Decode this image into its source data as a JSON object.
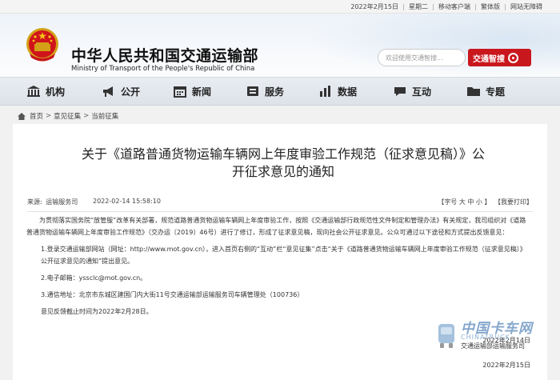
{
  "topbar": {
    "date": "2022年2月15日",
    "weekday": "星期二",
    "mobile": "移动客户端",
    "traditional": "繁体版",
    "accessibility": "网站无障碍"
  },
  "header": {
    "title": "中华人民共和国交通运输部",
    "subtitle": "Ministry of Transport of the People's Republic of China",
    "search_placeholder": "欢迎使用交通智搜...",
    "smart_search_label": "交通智搜"
  },
  "nav": {
    "items": [
      {
        "label": "机构",
        "icon": "building-icon"
      },
      {
        "label": "公开",
        "icon": "megaphone-icon"
      },
      {
        "label": "新闻",
        "icon": "calendar-icon"
      },
      {
        "label": "服务",
        "icon": "service-icon"
      },
      {
        "label": "数据",
        "icon": "bar-chart-icon"
      },
      {
        "label": "互动",
        "icon": "chat-icon"
      },
      {
        "label": "专题",
        "icon": "folder-icon"
      }
    ]
  },
  "breadcrumb": {
    "items": [
      "首页",
      "意见征集",
      "当前征集"
    ]
  },
  "article": {
    "title_line1": "关于《道路普通货物运输车辆网上年度审验工作规范（征求意见稿）》公",
    "title_line2": "开征求意见的通知",
    "source_label": "来源:",
    "source": "运输服务司",
    "time": "2022-02-14 15:58:10",
    "font_size_label": "【字号 大 中 小 】",
    "print_label": "【我要打印】",
    "paragraphs": [
      "为贯彻落实国务院“放管服”改革有关部署，规范道路普通货物运输车辆网上年度审验工作，按照《交通运输部行政规范性文件制定和管理办法》有关规定，我司组织对《道路普通货物运输车辆网上年度审验工作规范》（交办运〔2019〕46号）进行了修订，形成了征求意见稿，现向社会公开征求意见。公众可通过以下途径和方式提出反馈意见：",
      "1.登录交通运输部网站（网址：http://www.mot.gov.cn），进入首页右侧的“互动”栏“意见征集”点击“关于《道路普通货物运输车辆网上年度审验工作规范（征求意见稿）》公开征求意见的通知”提出意见。",
      "2.电子邮箱：yssclc@mot.gov.cn。",
      "3.通信地址：北京市东城区建国门内大街11号交通运输部运输服务司车辆管理处（100736）",
      "意见反馈截止时间为2022年2月28日。"
    ],
    "signature_date": "2022年2月14日",
    "bottom_date": "2022年2月15日"
  },
  "watermark": {
    "cn": "中国卡车网",
    "en": "CHINATRUCK",
    "sub": "交通运输部运输服务司"
  },
  "colors": {
    "accent_red": "#c9171e",
    "nav_bg": "#e3e7ec",
    "page_bg": "#f1f1f1"
  }
}
